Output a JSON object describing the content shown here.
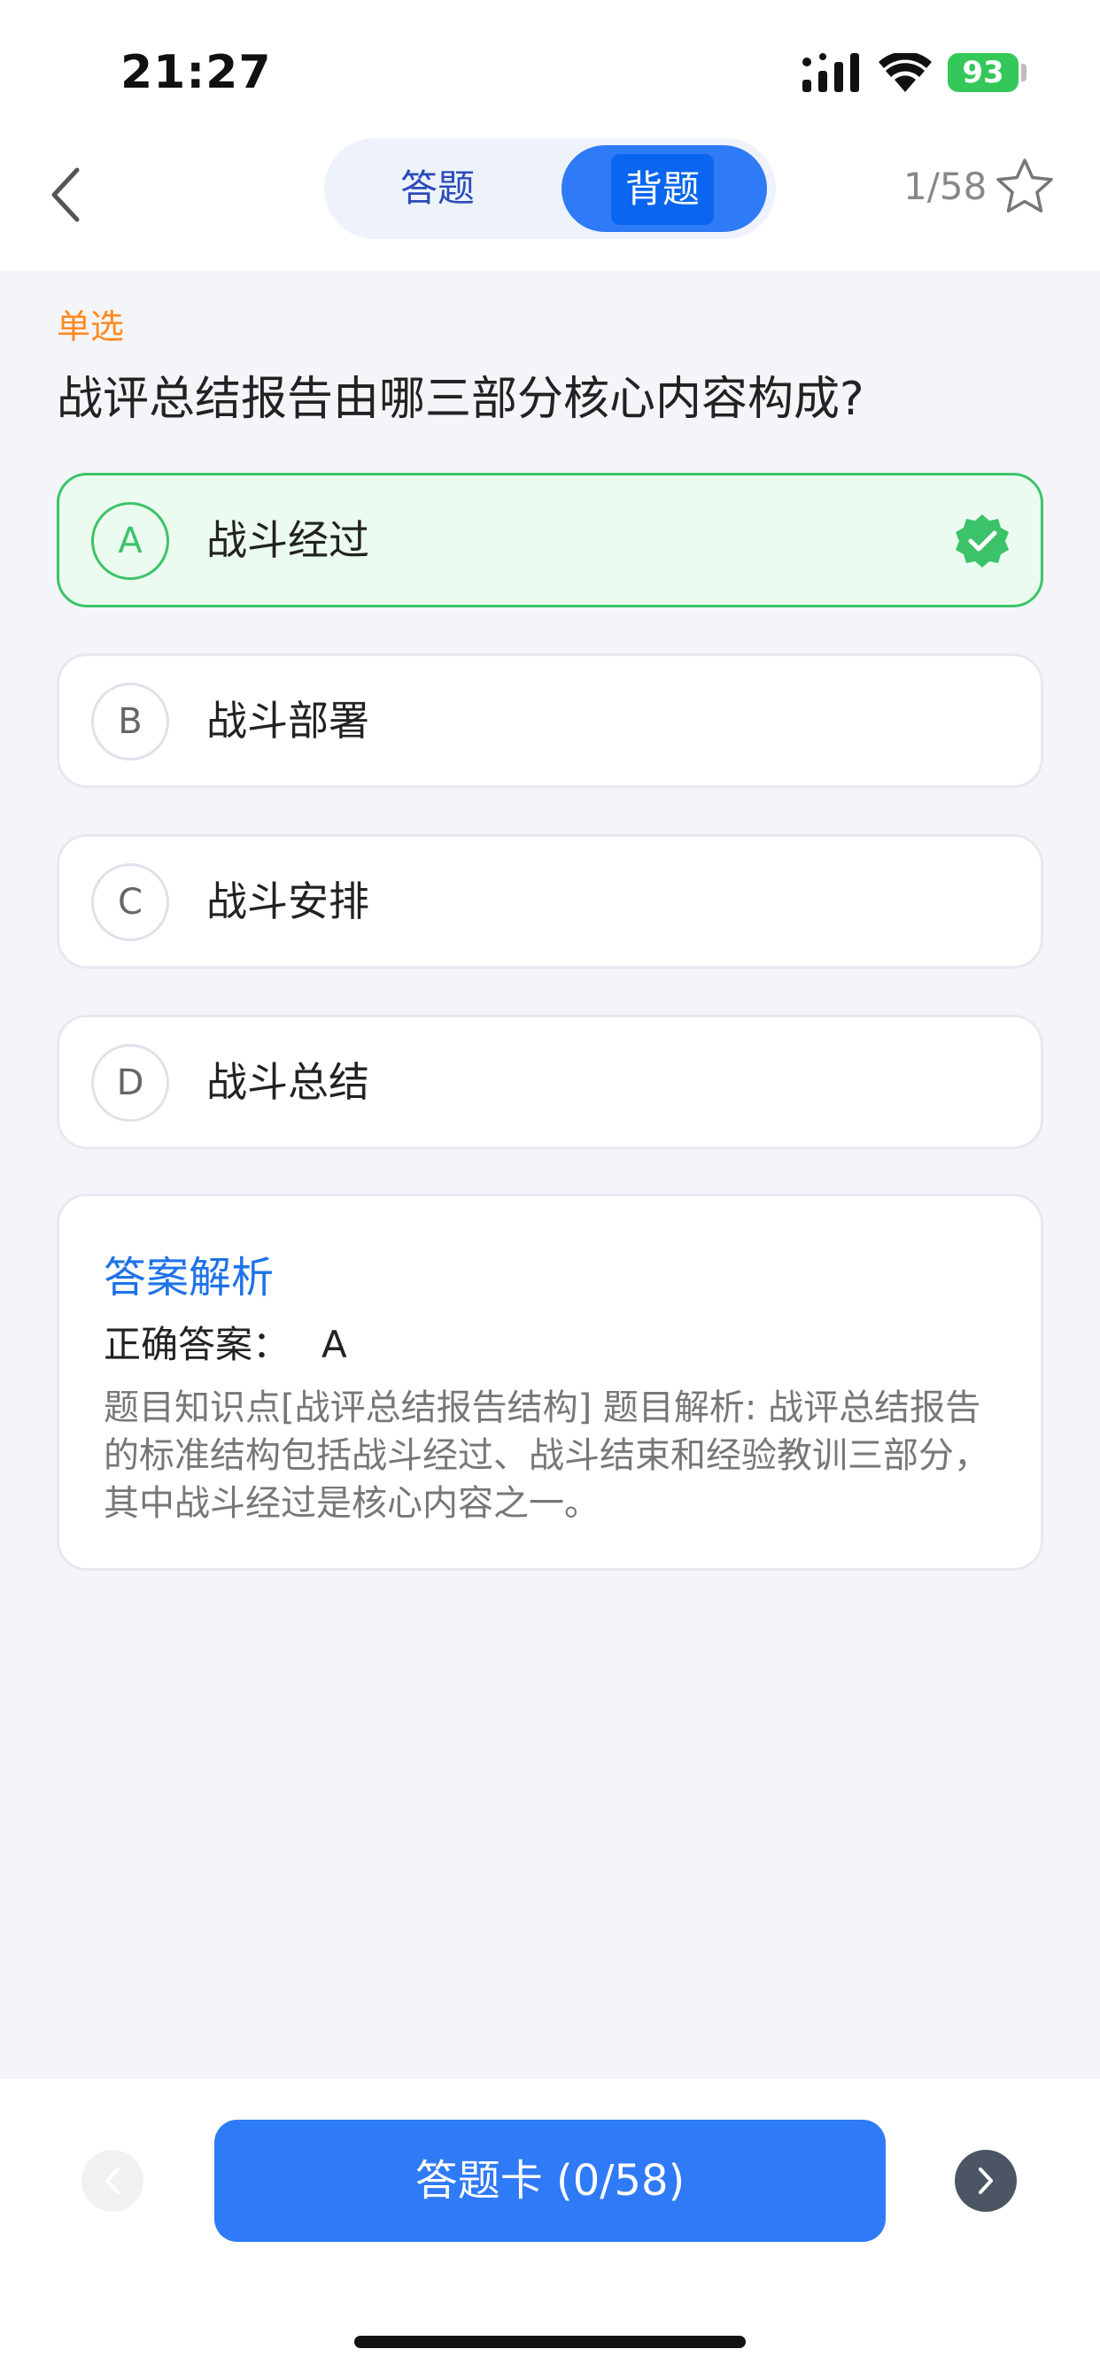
{
  "status": {
    "time": "21:27",
    "battery": "93"
  },
  "nav": {
    "tab_answer": "答题",
    "tab_study": "背题",
    "counter": "1/58"
  },
  "question": {
    "type": "单选",
    "text": "战评总结报告由哪三部分核心内容构成?",
    "options": [
      {
        "letter": "A",
        "text": "战斗经过"
      },
      {
        "letter": "B",
        "text": "战斗部署"
      },
      {
        "letter": "C",
        "text": "战斗安排"
      },
      {
        "letter": "D",
        "text": "战斗总结"
      }
    ]
  },
  "analysis": {
    "title": "答案解析",
    "answer_label": "正确答案：",
    "answer_value": "A",
    "body": "题目知识点[战评总结报告结构] 题目解析: 战评总结报告的标准结构包括战斗经过、战斗结束和经验教训三部分，其中战斗经过是核心内容之一。"
  },
  "bottom": {
    "card_button": "答题卡 (0/58)"
  },
  "colors": {
    "accent": "#2f7af6",
    "correct": "#3cc36a",
    "type_tag": "#ff8a1f"
  }
}
